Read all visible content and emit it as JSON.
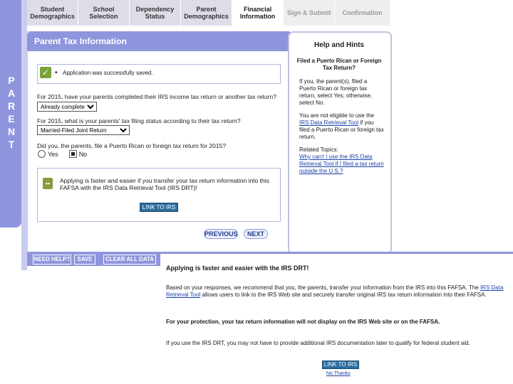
{
  "side_label": "PARENT",
  "tabs": [
    {
      "label": "Student Demographics",
      "state": "done"
    },
    {
      "label": "School Selection",
      "state": "done"
    },
    {
      "label": "Dependency Status",
      "state": "done"
    },
    {
      "label": "Parent Demographics",
      "state": "done"
    },
    {
      "label": "Financial Information",
      "state": "active"
    },
    {
      "label": "Sign & Submit",
      "state": "upcoming"
    },
    {
      "label": "Confirmation",
      "state": "upcoming"
    }
  ],
  "main": {
    "header": "Parent Tax Information",
    "saved_message": "Application was successfully saved.",
    "q1": {
      "text": "For 2015, have your parents completed their IRS income tax return or another tax return?",
      "value": "Already completed"
    },
    "q2": {
      "text": "For 2015, what is your parents' tax filing status according to their tax return?",
      "value": "Married-Filed Joint Return"
    },
    "q3": {
      "text": "Did you, the parents, file a Puerto Rican or foreign tax return for 2015?",
      "yes": "Yes",
      "no": "No",
      "selected": "No"
    },
    "drt_message": "Applying is faster and easier if you transfer your tax return information into this FAFSA with the IRS Data Retrieval Tool (IRS DRT)!",
    "link_to_irs": "LINK TO IRS",
    "previous": "PREVIOUS",
    "next": "NEXT"
  },
  "help": {
    "title": "Help and Hints",
    "subtitle": "Filed a Puerto Rican or Foreign Tax Return?",
    "p1": "If you, the parent(s), filed a Puerto Rican or foreign tax return, select Yes; otherwise, select No.",
    "p2_before": "You are not eligible to use the ",
    "p2_link": "IRS Data Retrieval Tool",
    "p2_after": " if you filed a Puerto Rican or foreign tax return.",
    "related_label": "Related Topics:",
    "related_link": "Why can't I use the IRS Data Retrieval Tool if I filed a tax return outside the U.S.?"
  },
  "bottom": {
    "need_help": "NEED HELP?",
    "save": "SAVE",
    "clear_all": "CLEAR ALL DATA"
  },
  "popup": {
    "title": "Applying is faster and easier with the IRS DRT!",
    "p1_before": "Based on your responses, we recommend that you, the parents, transfer your information from the IRS into this FAFSA. The ",
    "p1_link": "IRS Data Retrieval Tool",
    "p1_after": " allows users to link to the IRS Web site and securely transfer original IRS tax return information into their FAFSA.",
    "p2": "For your protection, your tax return information will not display on the IRS Web site or on the FAFSA.",
    "p3": "If you use the IRS DRT, you may not have to provide additional IRS documentation later to qualify for federal student aid.",
    "link_to_irs": "LINK TO IRS",
    "no_thanks": "No Thanks"
  },
  "colors": {
    "accent": "#8f95dc",
    "link": "#1a3faa",
    "button": "#2b6c9e"
  }
}
